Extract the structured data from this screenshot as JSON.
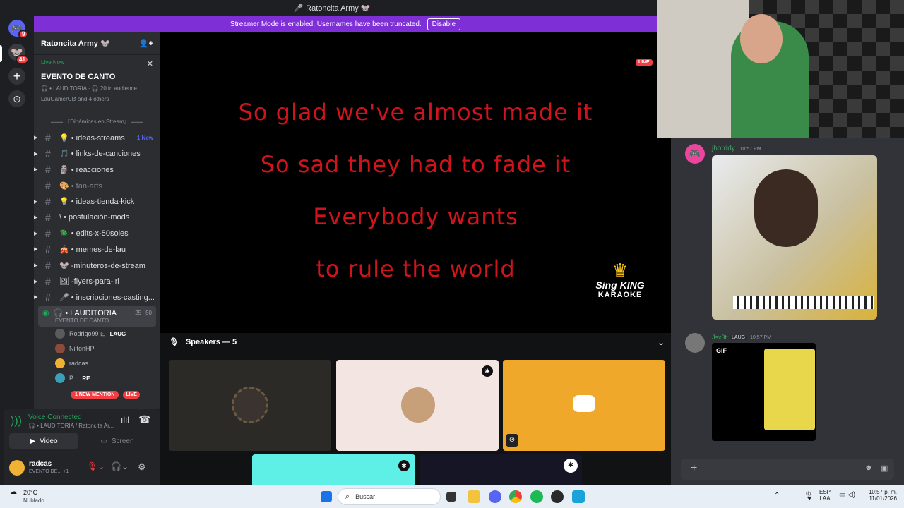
{
  "window": {
    "title": "Ratoncita Army 🐭"
  },
  "server_bar": {
    "dm_badge": "9",
    "server_badge": "41"
  },
  "banner": {
    "text": "Streamer Mode is enabled. Usernames have been truncated.",
    "button": "Disable"
  },
  "server": {
    "name": "Ratoncita Army 🐭"
  },
  "live_event": {
    "status": "Live Now",
    "title": "EVENTO DE CANTO",
    "channel_line": "🎧 • LAUDITORIA · 🎧 20 in audience",
    "people": "LauGamerCØ and 4 others"
  },
  "category": "═══ 『Dinámicas en Stream』 ═══",
  "channels": [
    {
      "label": "💡 • ideas-streams",
      "badge": "1 New",
      "muted": false
    },
    {
      "label": "🎵 • links-de-canciones",
      "badge": "",
      "muted": false
    },
    {
      "label": "🗿 • reacciones",
      "badge": "",
      "muted": false
    },
    {
      "label": "🎨 • fan-arts",
      "badge": "",
      "muted": true
    },
    {
      "label": "💡 • ideas-tienda-kick",
      "badge": "",
      "muted": false
    },
    {
      "label": "\\ • postulación-mods",
      "badge": "",
      "muted": false
    },
    {
      "label": "🪲 • edits-x-50soles",
      "badge": "",
      "muted": false
    },
    {
      "label": "🎪 • memes-de-lau",
      "badge": "",
      "muted": false
    },
    {
      "label": "🐭 -minuteros-de-stream",
      "badge": "",
      "muted": false
    },
    {
      "label": "🖼 -flyers-para-irl",
      "badge": "",
      "muted": false
    },
    {
      "label": "🎤 • inscripciones-casting...",
      "badge": "",
      "muted": false
    }
  ],
  "voice_channel": {
    "label": "🎧 • LAUDITORIA",
    "count": "25",
    "limit": "50",
    "event": "EVENTO DE CANTO"
  },
  "voice_users": [
    {
      "name": "Rodrigo99 ⊡",
      "tag": "LAUG",
      "color": "#5b5b5b"
    },
    {
      "name": "NiltonHP",
      "tag": "",
      "color": "#8b4a3a"
    },
    {
      "name": "radcas",
      "tag": "",
      "color": "#f0b232"
    },
    {
      "name": "P...",
      "tag": "RE",
      "color": "#3aa0b8"
    }
  ],
  "mention_pill": "1 NEW MENTION",
  "live_tag": "LIVE",
  "voice_panel": {
    "status": "Voice Connected",
    "location": "🎧 • LAUDITORIA / Ratoncita Ar...",
    "video_btn": "Video",
    "screen_btn": "Screen",
    "user": "radcas",
    "user_sub": "EVENTO DE... +1"
  },
  "stage": {
    "live_badge": "LIVE",
    "lyrics": [
      "So glad we've almost made it",
      "So sad they had to fade it",
      "Everybody wants",
      "to rule the world"
    ],
    "logo_top": "Sing KING",
    "logo_bottom": "KARAOKE"
  },
  "speakers": {
    "label": "Speakers — 5"
  },
  "chat": {
    "msg1": {
      "author": "jhorddy",
      "time": "10:57 PM"
    },
    "msg2": {
      "author": "Jsx3t",
      "tag": "LAUG",
      "time": "10:57 PM",
      "gif_label": "GIF"
    }
  },
  "taskbar": {
    "temp": "20°C",
    "weather": "Nublado",
    "search": "Buscar",
    "lang1": "ESP",
    "lang2": "LAA",
    "time": "10:57 p. m.",
    "date": "11/01/2026"
  },
  "colors": {
    "accent": "#7e2fd6",
    "live": "#f23f43",
    "lyric": "#d0141c",
    "green": "#23a55a"
  }
}
